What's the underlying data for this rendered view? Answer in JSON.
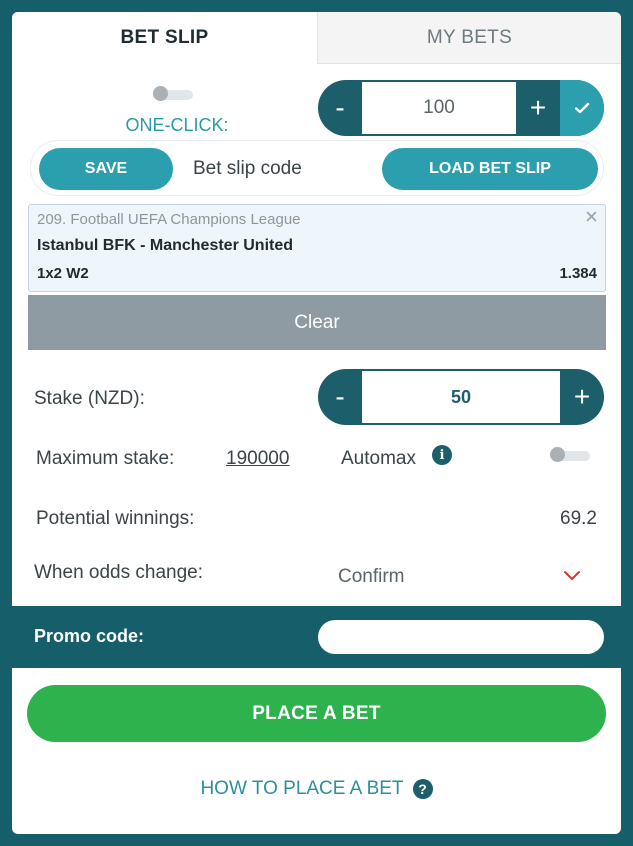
{
  "tabs": [
    {
      "label": "BET SLIP",
      "active": true
    },
    {
      "label": "MY BETS",
      "active": false
    }
  ],
  "one_click": {
    "label": "ONE-CLICK:",
    "enabled": false,
    "minus": "-",
    "value": "100",
    "plus": "+",
    "confirm_icon": "check-icon"
  },
  "bet_slip_code": {
    "save_label": "SAVE",
    "code_label": "Bet slip code",
    "load_label": "LOAD BET SLIP"
  },
  "bet": {
    "league": "209. Football UEFA Champions League",
    "match": "Istanbul BFK - Manchester United",
    "market": "1x2 W2",
    "odds": "1.384",
    "remove_icon": "close-icon"
  },
  "clear_label": "Clear",
  "stake": {
    "label": "Stake (NZD):",
    "minus": "-",
    "value": "50",
    "plus": "+"
  },
  "maximum_stake": {
    "label": "Maximum stake:",
    "value": "190000"
  },
  "automax": {
    "label": "Automax",
    "info_icon": "info-icon",
    "info_glyph": "i",
    "enabled": false
  },
  "potential_winnings": {
    "label": "Potential winnings:",
    "value": "69.2"
  },
  "odds_change": {
    "label": "When odds change:",
    "selected": "Confirm"
  },
  "promo": {
    "label": "Promo code:",
    "value": ""
  },
  "place_bet_label": "PLACE A BET",
  "how_to": {
    "label": "HOW TO PLACE A BET",
    "icon_glyph": "?"
  },
  "colors": {
    "background": "#175e6b",
    "accent": "#2c9fae",
    "place_bet": "#2eb24e",
    "clear": "#8f9ba3",
    "chevron": "#d9342b"
  }
}
